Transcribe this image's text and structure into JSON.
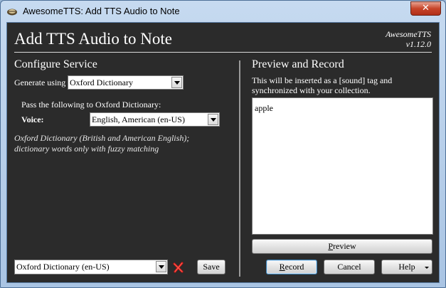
{
  "window": {
    "title": "AwesomeTTS: Add TTS Audio to Note",
    "close_glyph": "✕",
    "app_icon": "speaker-icon"
  },
  "header": {
    "title": "Add TTS Audio to Note",
    "brand": "AwesomeTTS",
    "version": "v1.12.0"
  },
  "configure": {
    "heading": "Configure Service",
    "generate_label": "Generate using",
    "service_selected": "Oxford Dictionary",
    "pass_label": "Pass the following to Oxford Dictionary:",
    "voice_label": "Voice:",
    "voice_selected": "English, American (en-US)",
    "note_line1": "Oxford Dictionary (British and American English);",
    "note_line2": "dictionary words only with fuzzy matching"
  },
  "preview": {
    "heading": "Preview and Record",
    "description": "This will be inserted as a [sound] tag and synchronized with your collection.",
    "text": "apple",
    "preview_button": {
      "mnemonic": "P",
      "rest": "review"
    }
  },
  "footer": {
    "preset_selected": "Oxford Dictionary (en-US)",
    "delete_icon": "red-x-icon",
    "save_label": "Save",
    "record": {
      "mnemonic": "R",
      "rest": "ecord"
    },
    "cancel_label": "Cancel",
    "help_label": "Help"
  },
  "colors": {
    "panel_bg": "#2b2b2b",
    "delete_red": "#d01616",
    "title_bar": "#b9d1ea"
  }
}
